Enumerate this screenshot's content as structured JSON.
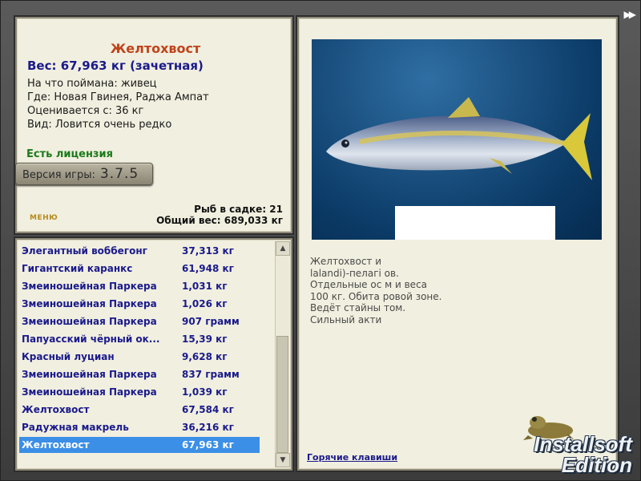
{
  "info": {
    "fish_name": "Желтохвост",
    "weight_line": "Вес: 67,963 кг (зачетная)",
    "caught_on": "На что поймана: живец",
    "location": "Где: Новая Гвинея, Раджа Ампат",
    "valued_from": "Оценивается с: 36 кг",
    "rarity": "Вид: Ловится очень редко",
    "license": "Есть лицензия",
    "version_label": "Версия игры:",
    "version_number": "3.7.5",
    "fish_in_cage": "Рыб в садке: 21",
    "total_weight": "Общий вес: 689,033 кг",
    "menu_label": "МЕНЮ"
  },
  "catch_list": [
    {
      "name": "Элегантный воббегонг",
      "weight": "37,313 кг"
    },
    {
      "name": "Гигантский каранкс",
      "weight": "61,948 кг"
    },
    {
      "name": "Змеиношейная Паркера",
      "weight": "1,031 кг"
    },
    {
      "name": "Змеиношейная Паркера",
      "weight": "1,026 кг"
    },
    {
      "name": "Змеиношейная Паркера",
      "weight": "907 грамм"
    },
    {
      "name": "Папуасский чёрный ок...",
      "weight": "15,39 кг"
    },
    {
      "name": "Красный луциан",
      "weight": "9,628 кг"
    },
    {
      "name": "Змеиношейная Паркера",
      "weight": "837 грамм"
    },
    {
      "name": "Змеиношейная Паркера",
      "weight": "1,039 кг"
    },
    {
      "name": "Желтохвост",
      "weight": "67,584 кг"
    },
    {
      "name": "Радужная макрель",
      "weight": "36,216 кг"
    },
    {
      "name": "Желтохвост",
      "weight": "67,963 кг"
    }
  ],
  "selected_index": 11,
  "description_lines": [
    "Желтохвост и",
    "lalandi)-пелагі                                                    ов.",
    "Отдельные ос                                               м и веса",
    "100 кг. Обита                                             ровой зоне.",
    "Ведёт стайны                                               том.",
    "Сильный акти"
  ],
  "hotkeys_link": "Горячие клавиши",
  "watermark": {
    "line1": "Installsoft",
    "line2": "Edition"
  },
  "icons": {
    "forward": "double-arrow-right-icon",
    "scroll_up": "chevron-up-icon",
    "scroll_down": "chevron-down-icon",
    "frog": "frog-icon"
  },
  "colors": {
    "fish_name": "#c0431a",
    "link_blue": "#1a1a8c",
    "selection": "#3b8fe6",
    "license_green": "#1a7a1a"
  }
}
